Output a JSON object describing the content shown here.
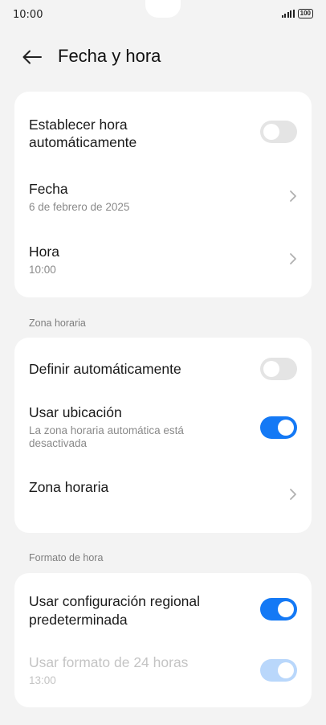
{
  "status_bar": {
    "time": "10:00",
    "battery": "100",
    "icons": [
      "signal-icon",
      "battery-icon"
    ]
  },
  "header": {
    "back_icon": "arrow-left-icon",
    "title": "Fecha y hora"
  },
  "card_date_time": {
    "auto_time": {
      "label": "Establecer hora automáticamente",
      "label_line1": "Establecer hora",
      "label_line2": "automáticamente",
      "enabled": false
    },
    "date": {
      "label": "Fecha",
      "value": "6 de febrero de 2025"
    },
    "time": {
      "label": "Hora",
      "value": "10:00"
    }
  },
  "section_timezone": {
    "label": "Zona horaria",
    "auto_define": {
      "label": "Definir automáticamente",
      "enabled": false
    },
    "use_location": {
      "label": "Usar ubicación",
      "sub_line1": "La zona horaria automática está",
      "sub_line2": "desactivada",
      "enabled": true
    },
    "timezone": {
      "label": "Zona horaria"
    }
  },
  "section_format": {
    "label": "Formato de hora",
    "regional": {
      "label_line1": "Usar configuración regional",
      "label_line2": "predeterminada",
      "enabled": true
    },
    "format_24h": {
      "label": "Usar formato de 24 horas",
      "value": "13:00",
      "enabled": true,
      "disabled": true
    }
  },
  "colors": {
    "accent": "#1479f5",
    "accent_disabled": "#b9d7fb",
    "toggle_off": "#e4e4e4",
    "background": "#f3f3f3",
    "card": "#ffffff"
  }
}
